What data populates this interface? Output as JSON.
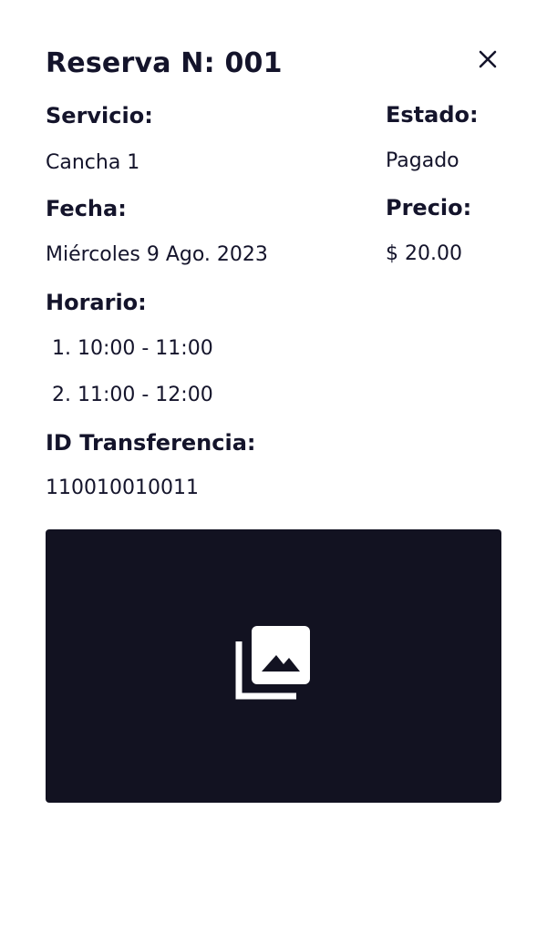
{
  "modal": {
    "title": "Reserva N: 001",
    "close_icon": "close-icon"
  },
  "details": {
    "servicio_label": "Servicio:",
    "servicio_value": "Cancha 1",
    "estado_label": "Estado:",
    "estado_value": "Pagado",
    "fecha_label": "Fecha:",
    "fecha_value": "Miércoles 9 Ago. 2023",
    "precio_label": "Precio:",
    "precio_value": "$ 20.00",
    "horario_label": "Horario:",
    "horario_items": [
      "1. 10:00 - 11:00",
      "2. 11:00 - 12:00"
    ],
    "transferencia_label": "ID Transferencia:",
    "transferencia_value": "110010010011"
  },
  "image": {
    "icon": "photo-library-icon"
  },
  "colors": {
    "text": "#14142b",
    "image_background": "#121221",
    "icon": "#ffffff"
  }
}
